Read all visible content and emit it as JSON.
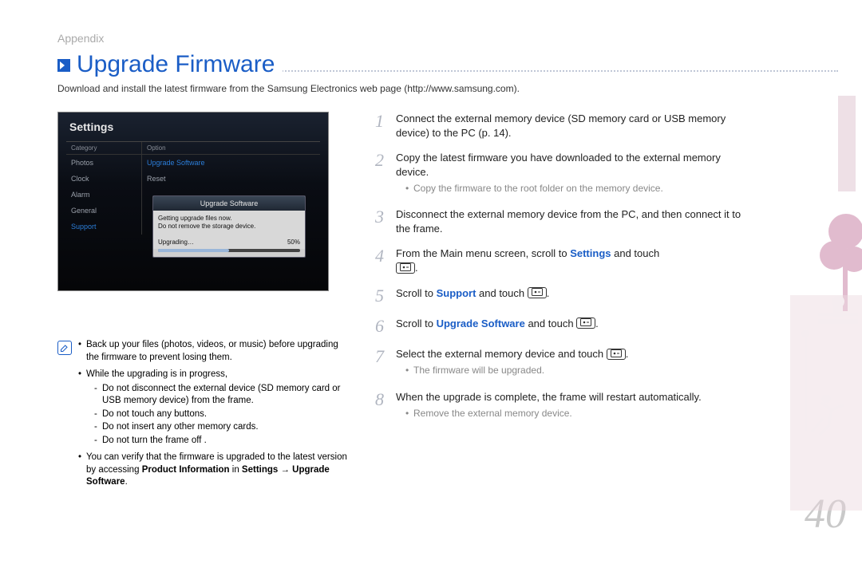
{
  "section": "Appendix",
  "title": "Upgrade Firmware",
  "intro": "Download and install the latest firmware from the Samsung Electronics web page (http://www.samsung.com).",
  "screenshot": {
    "title": "Settings",
    "categoryHeader": "Category",
    "optionHeader": "Option",
    "categories": [
      "Photos",
      "Clock",
      "Alarm",
      "General",
      "Support"
    ],
    "options": [
      "Upgrade Software",
      "Reset"
    ],
    "popup": {
      "header": "Upgrade Software",
      "line1": "Getting upgrade files now.",
      "line2": "Do not remove the storage device.",
      "progressLabel": "Upgrading…",
      "progressValue": "50%"
    }
  },
  "notes": {
    "n1": "Back up your files (photos, videos, or music) before upgrading the firmware to prevent losing them.",
    "n2": "While the upgrading is in progress,",
    "n2a": "Do not disconnect the external device (SD memory card or USB memory device) from the frame.",
    "n2b": "Do not touch any buttons.",
    "n2c": "Do not insert any other memory cards.",
    "n2d": "Do not turn the frame off .",
    "n3a": "You can verify that the firmware is upgraded to the latest version by accessing ",
    "n3b": "Product Information",
    "n3c": " in ",
    "n3d": "Settings → Upgrade Software",
    "n3e": "."
  },
  "steps": {
    "s1": "Connect the external memory device (SD memory card or USB memory device) to the PC (p. 14).",
    "s2": "Copy the latest firmware you have downloaded to the external memory device.",
    "s2a": "Copy the firmware to the root folder on the memory device.",
    "s3": "Disconnect the external memory device from the PC, and then connect it to the frame.",
    "s4a": "From the Main menu screen, scroll to ",
    "s4b": "Settings",
    "s4c": " and touch ",
    "s5a": "Scroll to ",
    "s5b": "Support",
    "s5c": " and touch ",
    "s6a": "Scroll to ",
    "s6b": "Upgrade Software",
    "s6c": " and touch ",
    "s7": "Select the external memory device and touch ",
    "s7a": "The firmware will be upgraded.",
    "s8": "When the upgrade is complete, the frame will restart automatically.",
    "s8a": "Remove the external memory device."
  },
  "pageNumber": "40"
}
